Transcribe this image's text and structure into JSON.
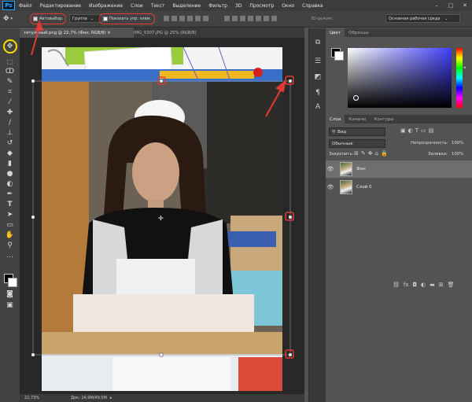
{
  "app": {
    "logo": "Ps"
  },
  "menu": {
    "items": [
      "Файл",
      "Редактирование",
      "Изображение",
      "Слои",
      "Текст",
      "Выделение",
      "Фильтр",
      "3D",
      "Просмотр",
      "Окно",
      "Справка"
    ]
  },
  "window_controls": {
    "minimize": "–",
    "maximize": "□",
    "close": "✕"
  },
  "options_bar": {
    "autoselect_label": "Автовыбор:",
    "autoselect_value": "Группа",
    "show_controls_label": "Показать упр. элем.",
    "mode_3d_label": "3D-режим:",
    "workspace": "Основная рабочая среда"
  },
  "tabs": [
    {
      "label": "титульный.png @ 22,7% (Фон, RGB/8) ✕"
    },
    {
      "label": "IMG_5307.JPG @ 25% (RGB/8)"
    }
  ],
  "status": {
    "zoom": "22,73%",
    "doc": "Док: 24,9M/49,5M"
  },
  "panels": {
    "color_tabs": [
      "Цвет",
      "Образцы"
    ],
    "layers_tabs": [
      "Слои",
      "Каналы",
      "Контуры"
    ],
    "kind_label": "Вид",
    "blend_mode": "Обычные",
    "opacity_label": "Непрозрачность:",
    "opacity_value": "100%",
    "lock_label": "Закрепить:",
    "fill_label": "Заливка:",
    "fill_value": "100%",
    "layers": [
      {
        "name": "Фон"
      },
      {
        "name": "Слой 0"
      }
    ]
  },
  "colors": {
    "accent_red": "#e53935",
    "highlight_yellow": "#f5e000",
    "ps_blue": "#31a8ff"
  }
}
